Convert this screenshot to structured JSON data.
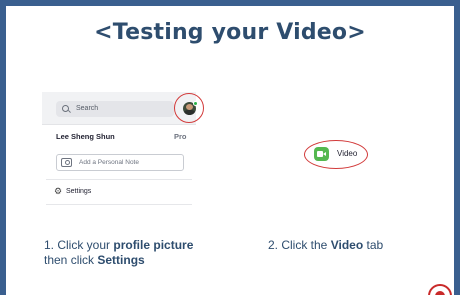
{
  "slide": {
    "title": "<Testing your Video>"
  },
  "zoom_menu": {
    "search_placeholder": "Search",
    "user_name": "Lee Sheng Shun",
    "plan_badge": "Pro",
    "note_placeholder": "Add a Personal Note",
    "settings_label": "Settings"
  },
  "video_tab": {
    "label": "Video"
  },
  "steps": {
    "step1": {
      "prefix": "1. Click your ",
      "bold1": "profile picture",
      "middle": " then click ",
      "bold2": "Settings"
    },
    "step2": {
      "prefix": "2. Click the ",
      "bold1": "Video",
      "suffix": " tab"
    }
  },
  "colors": {
    "frame": "#3a5f8f",
    "title": "#2e4d6e",
    "highlight": "#d23a3a",
    "video_green": "#54b84f"
  }
}
